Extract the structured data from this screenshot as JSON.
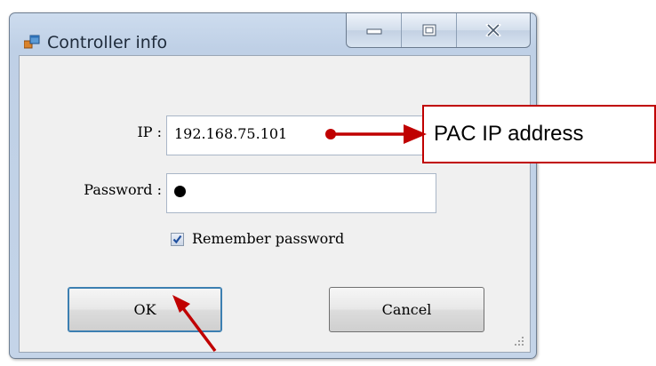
{
  "window": {
    "title": "Controller info",
    "icon": "app-window-icon",
    "caption_buttons": [
      "minimize-icon",
      "maximize-icon",
      "close-icon"
    ]
  },
  "form": {
    "ip_label": "IP :",
    "ip_value": "192.168.75.101",
    "password_label": "Password :",
    "password_masked_count": 1,
    "remember_label": "Remember password",
    "remember_checked": true
  },
  "buttons": {
    "ok": "OK",
    "cancel": "Cancel"
  },
  "annotation": {
    "callout_text": "PAC IP address",
    "color": "#c00000"
  }
}
